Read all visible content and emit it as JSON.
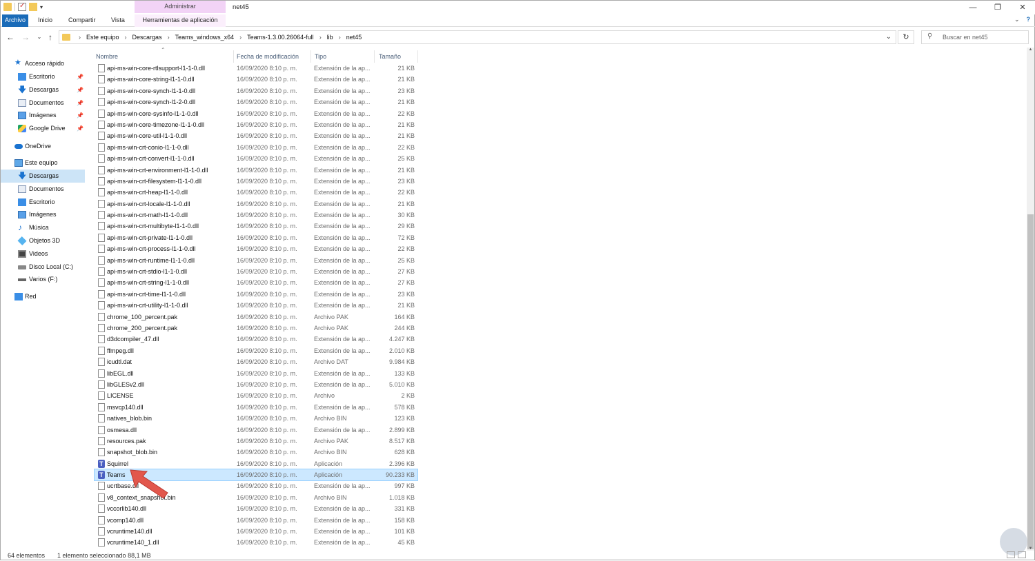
{
  "window": {
    "title": "net45",
    "context_group": "Administrar",
    "controls": [
      "—",
      "❐",
      "✕"
    ]
  },
  "ribbon": {
    "tabs": [
      "Archivo",
      "Inicio",
      "Compartir",
      "Vista",
      "Herramientas de aplicación"
    ]
  },
  "address": {
    "crumbs": [
      "Este equipo",
      "Descargas",
      "Teams_windows_x64",
      "Teams-1.3.00.26064-full",
      "lib",
      "net45"
    ],
    "search_placeholder": "Buscar en net45"
  },
  "nav": {
    "quick_access": "Acceso rápido",
    "quick_items": [
      {
        "label": "Escritorio",
        "icon": "desktop-icon"
      },
      {
        "label": "Descargas",
        "icon": "download-icon"
      },
      {
        "label": "Documentos",
        "icon": "documents-icon"
      },
      {
        "label": "Imágenes",
        "icon": "pictures-icon"
      },
      {
        "label": "Google Drive",
        "icon": "google-drive-icon"
      }
    ],
    "onedrive": "OneDrive",
    "this_pc": "Este equipo",
    "pc_items": [
      {
        "label": "Descargas",
        "icon": "download-icon",
        "selected": true
      },
      {
        "label": "Documentos",
        "icon": "documents-icon"
      },
      {
        "label": "Escritorio",
        "icon": "desktop-icon"
      },
      {
        "label": "Imágenes",
        "icon": "pictures-icon"
      },
      {
        "label": "Música",
        "icon": "music-icon"
      },
      {
        "label": "Objetos 3D",
        "icon": "3d-objects-icon"
      },
      {
        "label": "Videos",
        "icon": "videos-icon"
      },
      {
        "label": "Disco Local (C:)",
        "icon": "local-disk-icon"
      },
      {
        "label": "Varios (F:)",
        "icon": "drive-icon"
      }
    ],
    "network": "Red"
  },
  "columns": {
    "name": "Nombre",
    "date": "Fecha de modificación",
    "type": "Tipo",
    "size": "Tamaño"
  },
  "files": [
    {
      "name": "api-ms-win-core-rtlsupport-l1-1-0.dll",
      "date": "16/09/2020 8:10 p. m.",
      "type": "Extensión de la ap...",
      "size": "21 KB"
    },
    {
      "name": "api-ms-win-core-string-l1-1-0.dll",
      "date": "16/09/2020 8:10 p. m.",
      "type": "Extensión de la ap...",
      "size": "21 KB"
    },
    {
      "name": "api-ms-win-core-synch-l1-1-0.dll",
      "date": "16/09/2020 8:10 p. m.",
      "type": "Extensión de la ap...",
      "size": "23 KB"
    },
    {
      "name": "api-ms-win-core-synch-l1-2-0.dll",
      "date": "16/09/2020 8:10 p. m.",
      "type": "Extensión de la ap...",
      "size": "21 KB"
    },
    {
      "name": "api-ms-win-core-sysinfo-l1-1-0.dll",
      "date": "16/09/2020 8:10 p. m.",
      "type": "Extensión de la ap...",
      "size": "22 KB"
    },
    {
      "name": "api-ms-win-core-timezone-l1-1-0.dll",
      "date": "16/09/2020 8:10 p. m.",
      "type": "Extensión de la ap...",
      "size": "21 KB"
    },
    {
      "name": "api-ms-win-core-util-l1-1-0.dll",
      "date": "16/09/2020 8:10 p. m.",
      "type": "Extensión de la ap...",
      "size": "21 KB"
    },
    {
      "name": "api-ms-win-crt-conio-l1-1-0.dll",
      "date": "16/09/2020 8:10 p. m.",
      "type": "Extensión de la ap...",
      "size": "22 KB"
    },
    {
      "name": "api-ms-win-crt-convert-l1-1-0.dll",
      "date": "16/09/2020 8:10 p. m.",
      "type": "Extensión de la ap...",
      "size": "25 KB"
    },
    {
      "name": "api-ms-win-crt-environment-l1-1-0.dll",
      "date": "16/09/2020 8:10 p. m.",
      "type": "Extensión de la ap...",
      "size": "21 KB"
    },
    {
      "name": "api-ms-win-crt-filesystem-l1-1-0.dll",
      "date": "16/09/2020 8:10 p. m.",
      "type": "Extensión de la ap...",
      "size": "23 KB"
    },
    {
      "name": "api-ms-win-crt-heap-l1-1-0.dll",
      "date": "16/09/2020 8:10 p. m.",
      "type": "Extensión de la ap...",
      "size": "22 KB"
    },
    {
      "name": "api-ms-win-crt-locale-l1-1-0.dll",
      "date": "16/09/2020 8:10 p. m.",
      "type": "Extensión de la ap...",
      "size": "21 KB"
    },
    {
      "name": "api-ms-win-crt-math-l1-1-0.dll",
      "date": "16/09/2020 8:10 p. m.",
      "type": "Extensión de la ap...",
      "size": "30 KB"
    },
    {
      "name": "api-ms-win-crt-multibyte-l1-1-0.dll",
      "date": "16/09/2020 8:10 p. m.",
      "type": "Extensión de la ap...",
      "size": "29 KB"
    },
    {
      "name": "api-ms-win-crt-private-l1-1-0.dll",
      "date": "16/09/2020 8:10 p. m.",
      "type": "Extensión de la ap...",
      "size": "72 KB"
    },
    {
      "name": "api-ms-win-crt-process-l1-1-0.dll",
      "date": "16/09/2020 8:10 p. m.",
      "type": "Extensión de la ap...",
      "size": "22 KB"
    },
    {
      "name": "api-ms-win-crt-runtime-l1-1-0.dll",
      "date": "16/09/2020 8:10 p. m.",
      "type": "Extensión de la ap...",
      "size": "25 KB"
    },
    {
      "name": "api-ms-win-crt-stdio-l1-1-0.dll",
      "date": "16/09/2020 8:10 p. m.",
      "type": "Extensión de la ap...",
      "size": "27 KB"
    },
    {
      "name": "api-ms-win-crt-string-l1-1-0.dll",
      "date": "16/09/2020 8:10 p. m.",
      "type": "Extensión de la ap...",
      "size": "27 KB"
    },
    {
      "name": "api-ms-win-crt-time-l1-1-0.dll",
      "date": "16/09/2020 8:10 p. m.",
      "type": "Extensión de la ap...",
      "size": "23 KB"
    },
    {
      "name": "api-ms-win-crt-utility-l1-1-0.dll",
      "date": "16/09/2020 8:10 p. m.",
      "type": "Extensión de la ap...",
      "size": "21 KB"
    },
    {
      "name": "chrome_100_percent.pak",
      "date": "16/09/2020 8:10 p. m.",
      "type": "Archivo PAK",
      "size": "164 KB"
    },
    {
      "name": "chrome_200_percent.pak",
      "date": "16/09/2020 8:10 p. m.",
      "type": "Archivo PAK",
      "size": "244 KB"
    },
    {
      "name": "d3dcompiler_47.dll",
      "date": "16/09/2020 8:10 p. m.",
      "type": "Extensión de la ap...",
      "size": "4.247 KB"
    },
    {
      "name": "ffmpeg.dll",
      "date": "16/09/2020 8:10 p. m.",
      "type": "Extensión de la ap...",
      "size": "2.010 KB"
    },
    {
      "name": "icudtl.dat",
      "date": "16/09/2020 8:10 p. m.",
      "type": "Archivo DAT",
      "size": "9.984 KB"
    },
    {
      "name": "libEGL.dll",
      "date": "16/09/2020 8:10 p. m.",
      "type": "Extensión de la ap...",
      "size": "133 KB"
    },
    {
      "name": "libGLESv2.dll",
      "date": "16/09/2020 8:10 p. m.",
      "type": "Extensión de la ap...",
      "size": "5.010 KB"
    },
    {
      "name": "LICENSE",
      "date": "16/09/2020 8:10 p. m.",
      "type": "Archivo",
      "size": "2 KB"
    },
    {
      "name": "msvcp140.dll",
      "date": "16/09/2020 8:10 p. m.",
      "type": "Extensión de la ap...",
      "size": "578 KB"
    },
    {
      "name": "natives_blob.bin",
      "date": "16/09/2020 8:10 p. m.",
      "type": "Archivo BIN",
      "size": "123 KB"
    },
    {
      "name": "osmesa.dll",
      "date": "16/09/2020 8:10 p. m.",
      "type": "Extensión de la ap...",
      "size": "2.899 KB"
    },
    {
      "name": "resources.pak",
      "date": "16/09/2020 8:10 p. m.",
      "type": "Archivo PAK",
      "size": "8.517 KB"
    },
    {
      "name": "snapshot_blob.bin",
      "date": "16/09/2020 8:10 p. m.",
      "type": "Archivo BIN",
      "size": "628 KB"
    },
    {
      "name": "Squirrel",
      "date": "16/09/2020 8:10 p. m.",
      "type": "Aplicación",
      "size": "2.396 KB",
      "app": true
    },
    {
      "name": "Teams",
      "date": "16/09/2020 8:10 p. m.",
      "type": "Aplicación",
      "size": "90.233 KB",
      "app": true,
      "selected": true
    },
    {
      "name": "ucrtbase.dll",
      "date": "16/09/2020 8:10 p. m.",
      "type": "Extensión de la ap...",
      "size": "997 KB"
    },
    {
      "name": "v8_context_snapshot.bin",
      "date": "16/09/2020 8:10 p. m.",
      "type": "Archivo BIN",
      "size": "1.018 KB"
    },
    {
      "name": "vccorlib140.dll",
      "date": "16/09/2020 8:10 p. m.",
      "type": "Extensión de la ap...",
      "size": "331 KB"
    },
    {
      "name": "vcomp140.dll",
      "date": "16/09/2020 8:10 p. m.",
      "type": "Extensión de la ap...",
      "size": "158 KB"
    },
    {
      "name": "vcruntime140.dll",
      "date": "16/09/2020 8:10 p. m.",
      "type": "Extensión de la ap...",
      "size": "101 KB"
    },
    {
      "name": "vcruntime140_1.dll",
      "date": "16/09/2020 8:10 p. m.",
      "type": "Extensión de la ap...",
      "size": "45 KB"
    }
  ],
  "status": {
    "count": "64 elementos",
    "selection": "1 elemento seleccionado  88,1 MB"
  },
  "colors": {
    "file_tab": "#1a6bb8",
    "context_tab": "#f2d3f6",
    "selection": "#cce8ff",
    "annotation_arrow": "#e2574c"
  }
}
